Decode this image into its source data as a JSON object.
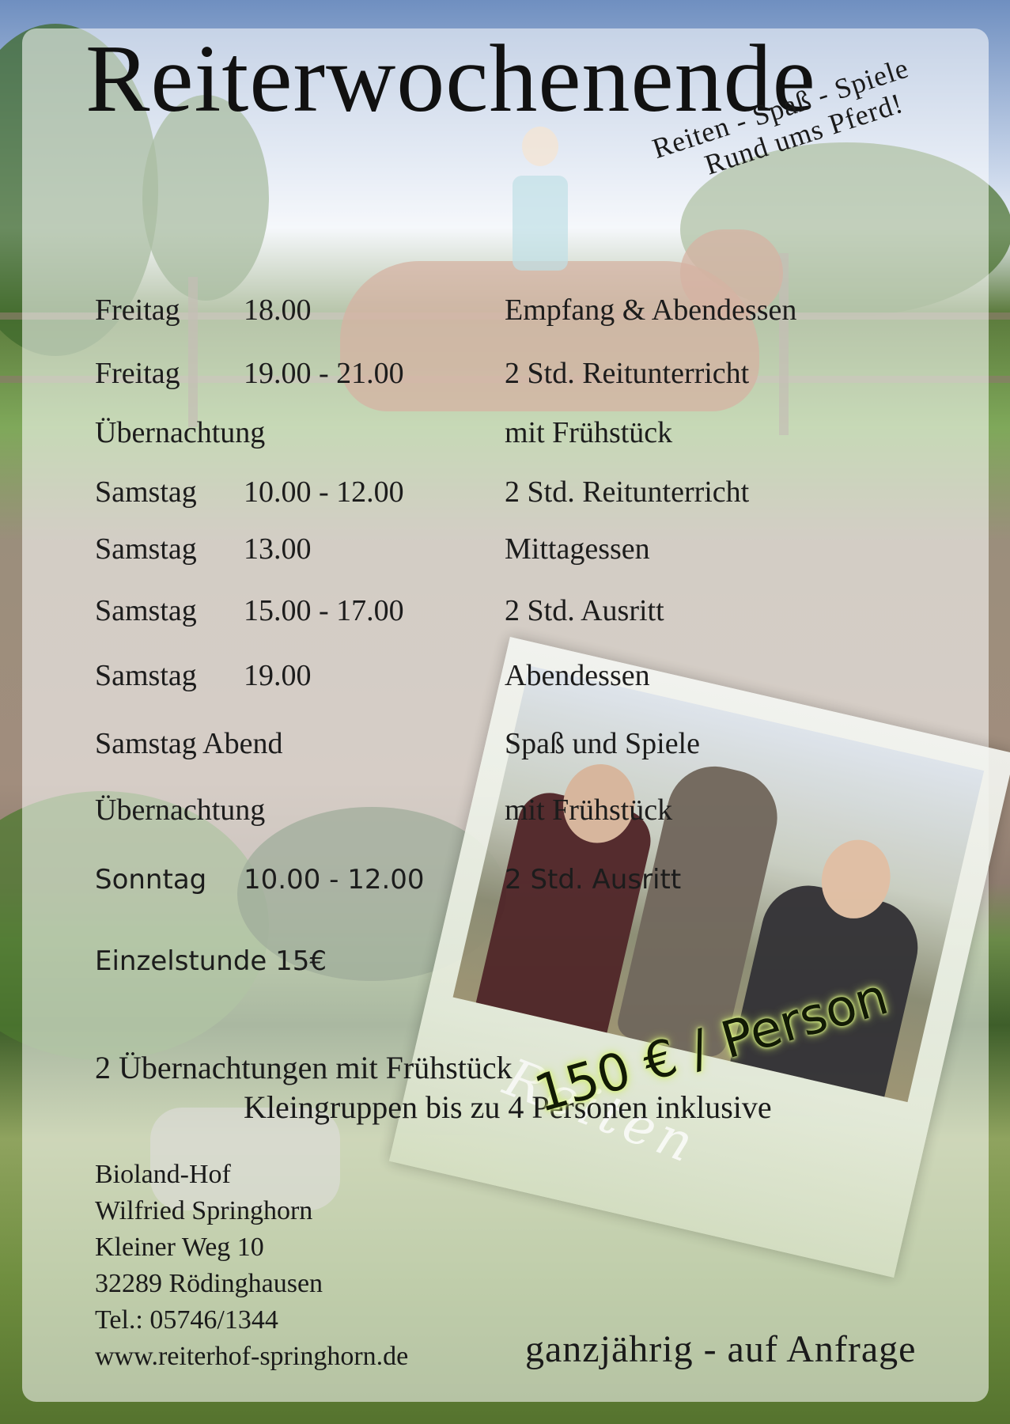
{
  "title": "Reiterwochenende",
  "tagline": {
    "line1": "Reiten - Spaß - Spiele",
    "line2": "Rund ums Pferd!"
  },
  "schedule": [
    {
      "day": "Freitag",
      "time": "18.00",
      "activity": "Empfang & Abendessen"
    },
    {
      "day": "Freitag",
      "time": "19.00 - 21.00",
      "activity": "2 Std. Reitunterricht"
    },
    {
      "day": "Übernachtung",
      "time": "",
      "activity": "mit Frühstück"
    },
    {
      "day": "Samstag",
      "time": "10.00 - 12.00",
      "activity": "2 Std. Reitunterricht"
    },
    {
      "day": "Samstag",
      "time": "13.00",
      "activity": "Mittagessen"
    },
    {
      "day": "Samstag",
      "time": "15.00 - 17.00",
      "activity": "2 Std. Ausritt"
    },
    {
      "day": "Samstag",
      "time": "19.00",
      "activity": "Abendessen"
    },
    {
      "day": "Samstag Abend",
      "time": "",
      "activity": "Spaß und Spiele"
    },
    {
      "day": "Übernachtung",
      "time": "",
      "activity": "mit Frühstück"
    },
    {
      "day": "Sonntag",
      "time": "10.00 - 12.00",
      "activity": "2 Std. Ausritt"
    }
  ],
  "single_lesson": "Einzelstunde 15€",
  "summary": {
    "line1": "2 Übernachtungen mit Frühstück",
    "line2": "Kleingruppen bis zu 4 Personen inklusive"
  },
  "photo_caption": "Reiten",
  "price": "150 € / Person",
  "address": {
    "farm": "Bioland-Hof",
    "owner": "Wilfried Springhorn",
    "street": "Kleiner Weg 10",
    "city": "32289 Rödinghausen",
    "phone": "Tel.: 05746/1344",
    "web": "www.reiterhof-springhorn.de"
  },
  "availability": "ganzjährig - auf Anfrage"
}
